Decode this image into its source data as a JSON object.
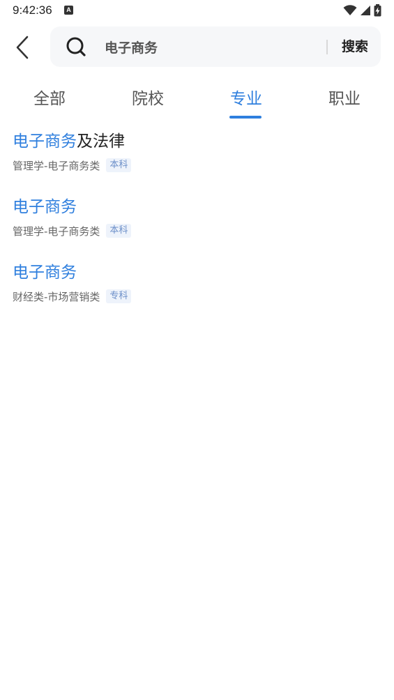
{
  "status_bar": {
    "time": "9:42:36",
    "notification_icon": "A",
    "icons": [
      "wifi-icon",
      "signal-icon",
      "battery-charging-icon"
    ]
  },
  "search": {
    "query": "电子商务",
    "button_label": "搜索"
  },
  "tabs": [
    {
      "label": "全部",
      "active": false
    },
    {
      "label": "院校",
      "active": false
    },
    {
      "label": "专业",
      "active": true
    },
    {
      "label": "职业",
      "active": false
    }
  ],
  "results": [
    {
      "highlight": "电子商务",
      "rest": "及法律",
      "path": "管理学-电子商务类",
      "badge": "本科"
    },
    {
      "highlight": "电子商务",
      "rest": "",
      "path": "管理学-电子商务类",
      "badge": "本科"
    },
    {
      "highlight": "电子商务",
      "rest": "",
      "path": "财经类-市场营销类",
      "badge": "专科"
    }
  ],
  "colors": {
    "accent": "#2f7fde",
    "badge_bg": "#eef3fb",
    "badge_text": "#6c8fc9",
    "search_bg": "#f6f7f9"
  }
}
